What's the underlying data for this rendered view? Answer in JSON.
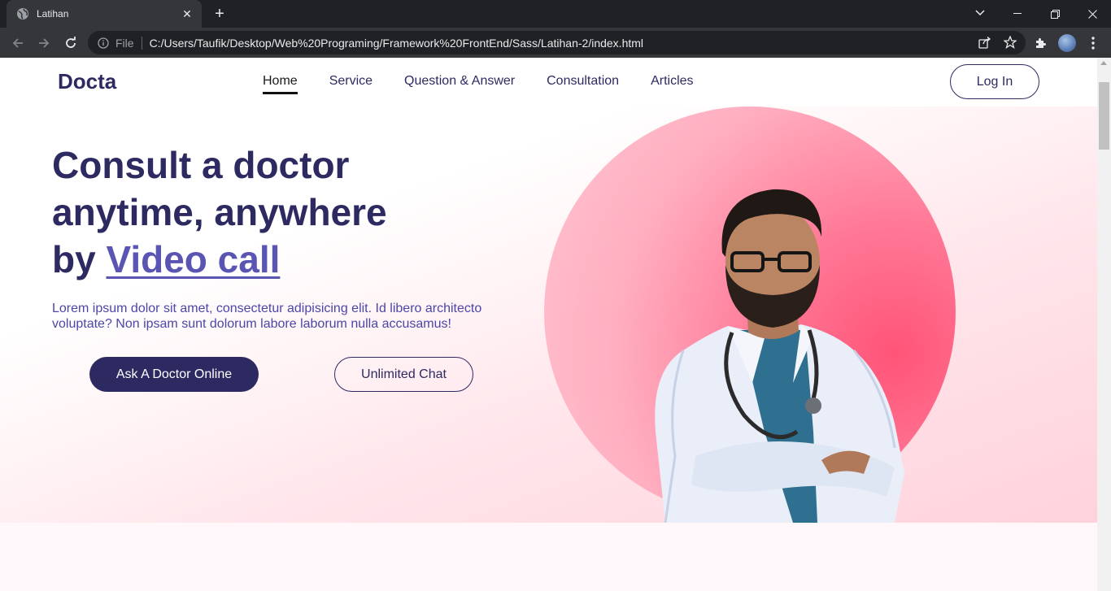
{
  "browser": {
    "tab_title": "Latihan",
    "new_tab_symbol": "+",
    "omnibox_scheme": "File",
    "url": "C:/Users/Taufik/Desktop/Web%20Programing/Framework%20FrontEnd/Sass/Latihan-2/index.html"
  },
  "header": {
    "logo": "Docta",
    "nav": [
      {
        "label": "Home",
        "active": true
      },
      {
        "label": "Service",
        "active": false
      },
      {
        "label": "Question & Answer",
        "active": false
      },
      {
        "label": "Consultation",
        "active": false
      },
      {
        "label": "Articles",
        "active": false
      }
    ],
    "login_label": "Log In"
  },
  "hero": {
    "title_line1": "Consult a doctor",
    "title_line2": "anytime, anywhere",
    "title_line3_prefix": "by",
    "title_highlight": "Video call",
    "description": "Lorem ipsum dolor sit amet, consectetur adipisicing elit. Id libero architecto voluptate? Non ipsam sunt dolorum labore laborum nulla accusamus!",
    "primary_button": "Ask A Doctor Online",
    "secondary_button": "Unlimited Chat"
  },
  "colors": {
    "brand": "#2d2a62",
    "accent": "#5a55b3",
    "circle": "#ff5478"
  }
}
